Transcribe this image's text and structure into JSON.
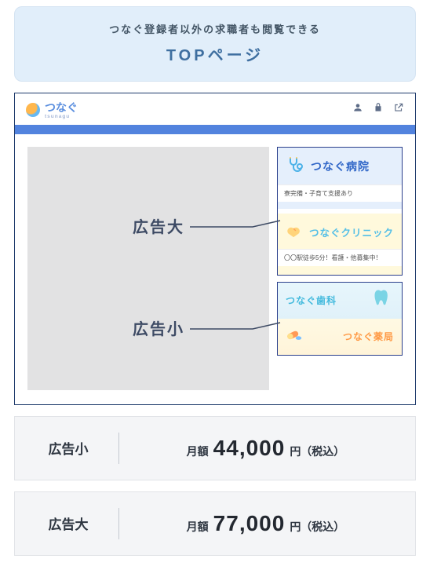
{
  "banner": {
    "subtitle": "つなぐ登録者以外の求職者も閲覧できる",
    "title": "TOPページ"
  },
  "header": {
    "logo_text": "つなぐ",
    "logo_sub": "tsunagu",
    "icons": [
      "user-icon",
      "lock-icon",
      "external-icon"
    ]
  },
  "callouts": {
    "large": "広告大",
    "small": "広告小"
  },
  "ads": {
    "large": [
      {
        "title": "つなぐ病院",
        "footer": "寮完備・子育て支援あり",
        "icon": "stethoscope-icon"
      },
      {
        "title": "つなぐクリニック",
        "footer": "〇〇駅徒歩5分！看護・他募集中！",
        "icon": "handshake-icon"
      }
    ],
    "small": [
      {
        "title": "つなぐ歯科",
        "icon": "tooth-icon"
      },
      {
        "title": "つなぐ薬局",
        "icon": "pill-icon"
      }
    ]
  },
  "pricing": [
    {
      "label": "広告小",
      "prefix": "月額",
      "amount": "44,000",
      "suffix": "円（税込）"
    },
    {
      "label": "広告大",
      "prefix": "月額",
      "amount": "77,000",
      "suffix": "円（税込）"
    }
  ]
}
